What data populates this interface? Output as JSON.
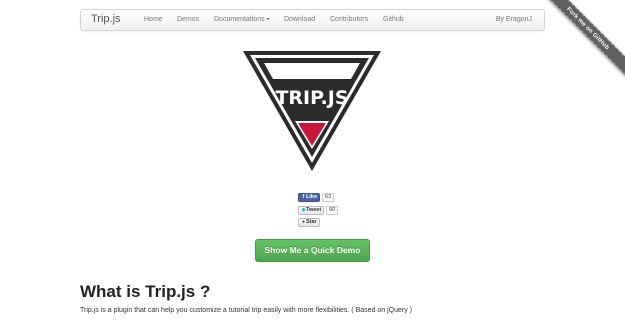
{
  "navbar": {
    "brand": "Trip.js",
    "links": [
      "Home",
      "Demos",
      "Documentations",
      "Download",
      "Contributors",
      "Github"
    ],
    "author": "By EragonJ"
  },
  "ribbon": {
    "text": "Fork me on GitHub"
  },
  "logo": {
    "text": "TRIP.JS",
    "colors": {
      "dark": "#2b2b2b",
      "light": "#ffffff",
      "accent": "#c8173a"
    }
  },
  "social": {
    "like": {
      "label": "Like",
      "count": "63"
    },
    "tweet": {
      "label": "Tweet",
      "count": "60"
    },
    "star": {
      "label": "Star"
    }
  },
  "demo_button": {
    "label": "Show Me a Quick Demo",
    "color": "#5bb75b"
  },
  "content": {
    "heading": "What is Trip.js ?",
    "description": "Trip.js is a plugin that can help you customize a tutorial trip easily with more flexibilities. ( Based on jQuery )"
  }
}
